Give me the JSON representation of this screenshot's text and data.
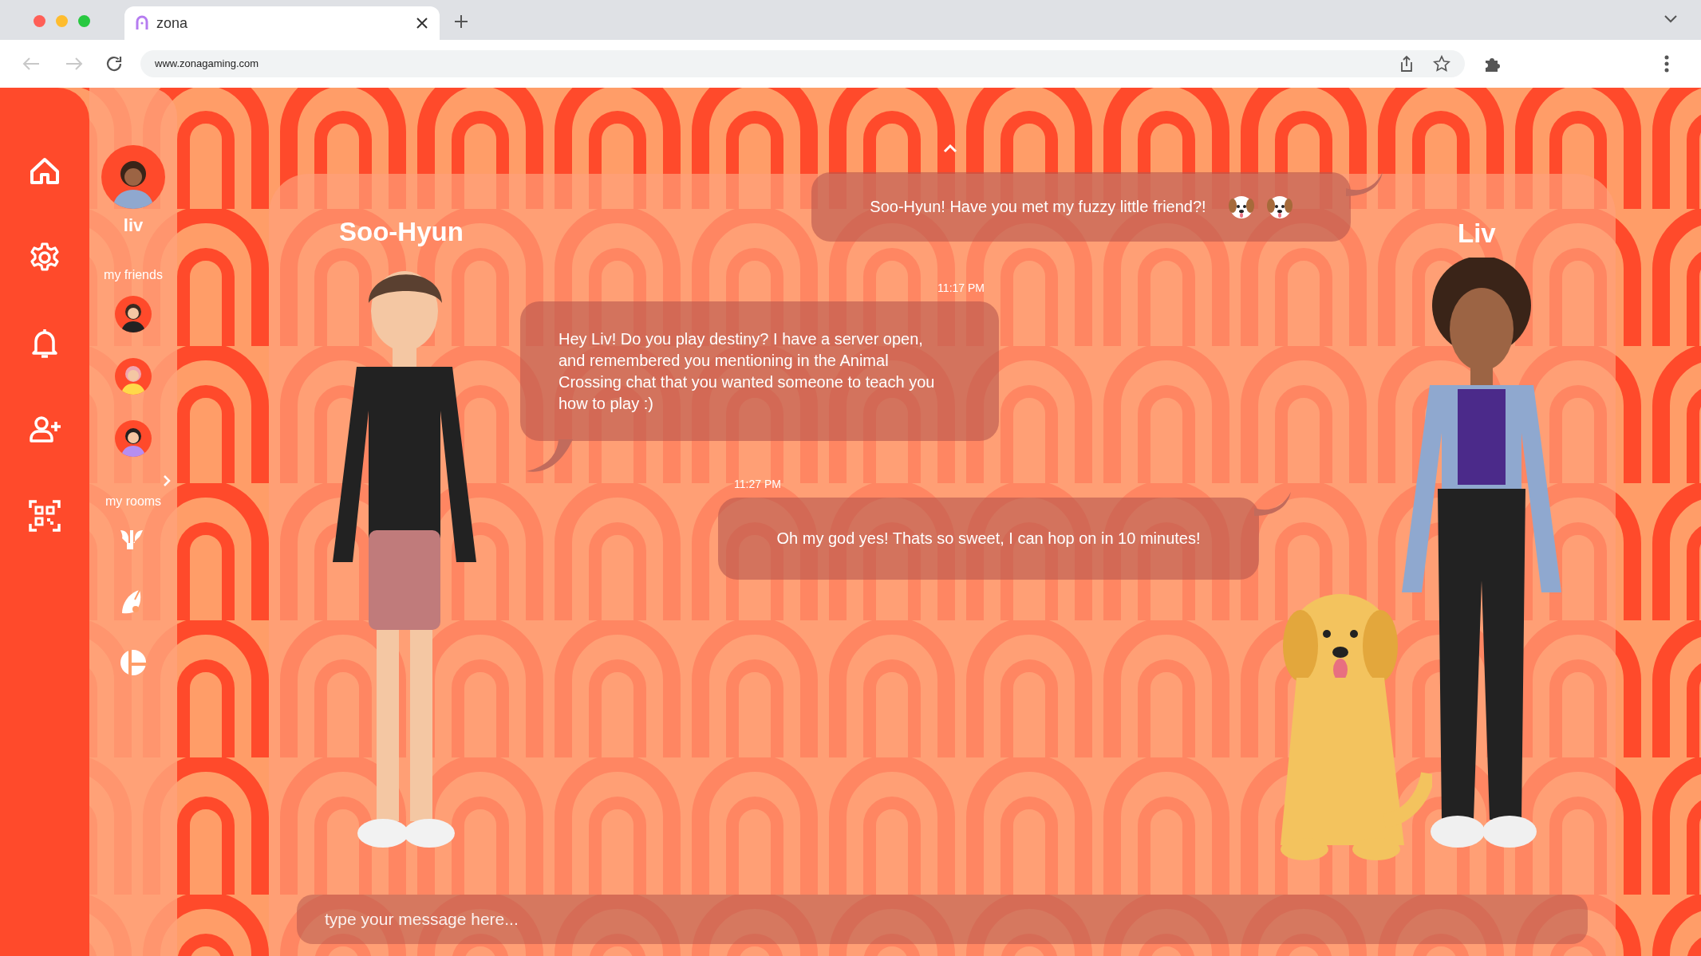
{
  "browser": {
    "tabs": [
      {
        "title": "zona",
        "selected": true
      }
    ],
    "back": {
      "disabled": true
    },
    "forward": {
      "disabled": true
    },
    "url": "www.zonagaming.com"
  },
  "nav": {
    "items": [
      {
        "kind": "home"
      },
      {
        "kind": "settings"
      },
      {
        "kind": "notifications"
      },
      {
        "kind": "add-friend"
      },
      {
        "kind": "qr"
      }
    ]
  },
  "profile": {
    "name": "liv"
  },
  "friends": {
    "title": "my friends",
    "items": [
      {
        "kind": "friend"
      },
      {
        "kind": "friend"
      },
      {
        "kind": "friend"
      }
    ]
  },
  "rooms": {
    "title": "my rooms",
    "items": [
      {
        "kind": "destiny"
      },
      {
        "kind": "leaf"
      },
      {
        "kind": "smash"
      }
    ]
  },
  "chat": {
    "left_name": "Soo-Hyun",
    "right_name": "Liv",
    "messages": [
      {
        "kind": "sent",
        "text": "Soo-Hyun! Have you met my fuzzy little friend?!"
      },
      {
        "kind": "received",
        "time": "11:17 PM",
        "text": "Hey Liv! Do you play destiny? I have a server open, and remembered you mentioning in the Animal Crossing chat that you wanted someone to teach you how to play :)"
      },
      {
        "kind": "sent",
        "time": "11:27 PM",
        "text": "Oh my god yes! Thats so sweet, I can hop on in 10 minutes!"
      }
    ],
    "input": {
      "placeholder": "type your message here..."
    }
  }
}
